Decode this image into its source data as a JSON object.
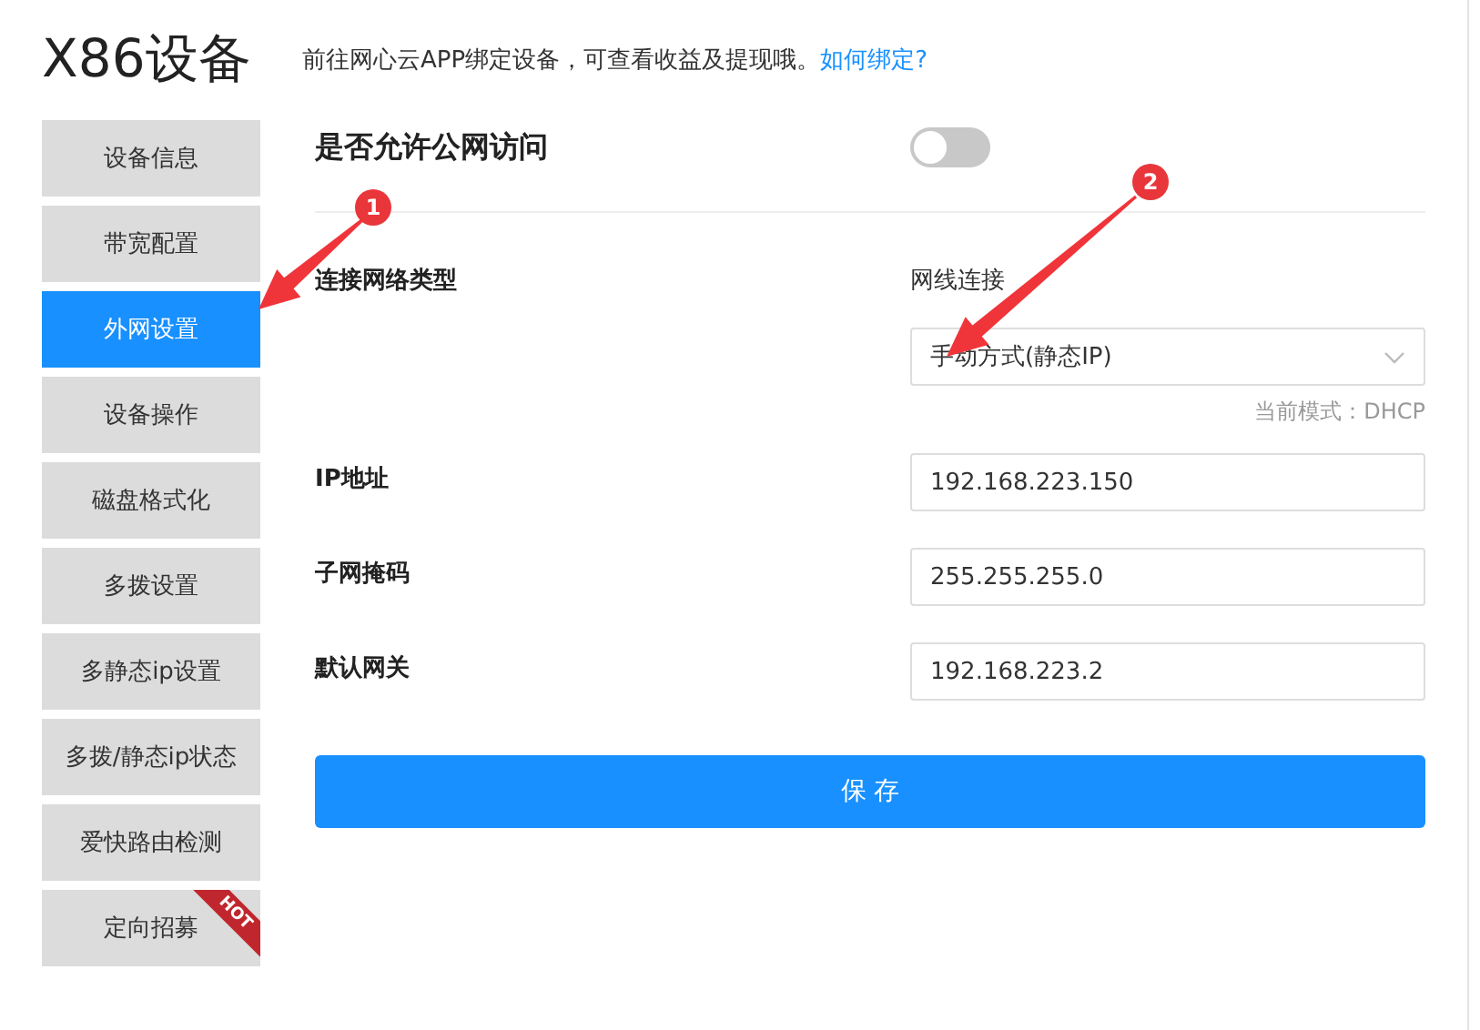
{
  "title": "X86设备",
  "notice": {
    "text": "前往网心云APP绑定设备，可查看收益及提现哦。",
    "link": "如何绑定?"
  },
  "sidebar": {
    "items": [
      {
        "label": "设备信息",
        "selected": false
      },
      {
        "label": "带宽配置",
        "selected": false
      },
      {
        "label": "外网设置",
        "selected": true
      },
      {
        "label": "设备操作",
        "selected": false
      },
      {
        "label": "磁盘格式化",
        "selected": false
      },
      {
        "label": "多拨设置",
        "selected": false
      },
      {
        "label": "多静态ip设置",
        "selected": false
      },
      {
        "label": "多拨/静态ip状态",
        "selected": false
      },
      {
        "label": "爱快路由检测",
        "selected": false
      },
      {
        "label": "定向招募",
        "selected": false,
        "badge": "HOT"
      }
    ]
  },
  "public_access": {
    "label": "是否允许公网访问",
    "on": false
  },
  "connection": {
    "label": "连接网络类型",
    "type": "网线连接",
    "select": {
      "value": "手动方式(静态IP)"
    },
    "mode_hint": "当前模式：DHCP"
  },
  "fields": [
    {
      "label": "IP地址",
      "value": "192.168.223.150"
    },
    {
      "label": "子网掩码",
      "value": "255.255.255.0"
    },
    {
      "label": "默认网关",
      "value": "192.168.223.2"
    }
  ],
  "save_button": "保 存",
  "annotations": [
    {
      "number": "1"
    },
    {
      "number": "2"
    }
  ]
}
